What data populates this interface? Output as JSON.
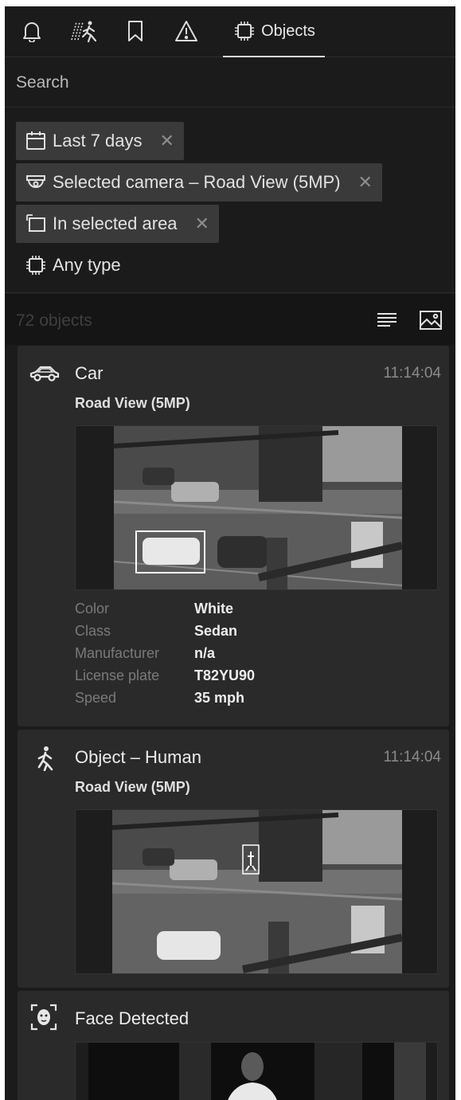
{
  "tabs": {
    "bell_icon": "bell-icon",
    "motion_icon": "motion-human-icon",
    "bookmark_icon": "bookmark-icon",
    "alert_icon": "warning-triangle-icon",
    "objects_icon": "chip-icon",
    "objects_label": "Objects"
  },
  "search": {
    "placeholder": "Search",
    "value": ""
  },
  "filters": {
    "date": "Last 7 days",
    "camera": "Selected camera – Road View (5MP)",
    "area": "In selected area",
    "type": "Any type",
    "remove_glyph": "✕"
  },
  "results": {
    "count_text": "72 objects"
  },
  "cards": [
    {
      "icon": "car-icon",
      "title": "Car",
      "time": "11:14:04",
      "camera": "Road View (5MP)",
      "attributes": [
        {
          "key": "Color",
          "value": "White"
        },
        {
          "key": "Class",
          "value": "Sedan"
        },
        {
          "key": "Manufacturer",
          "value": "n/a"
        },
        {
          "key": "License plate",
          "value": "T82YU90"
        },
        {
          "key": "Speed",
          "value": "35 mph"
        }
      ]
    },
    {
      "icon": "human-walking-icon",
      "title": "Object – Human",
      "time": "11:14:04",
      "camera": "Road View (5MP)"
    },
    {
      "icon": "face-scan-icon",
      "title": "Face Detected"
    }
  ],
  "colors": {
    "panel_bg": "#1b1b1b",
    "card_bg": "#2a2a2a",
    "chip_bg": "#3a3a3a",
    "text": "#e6e6e6",
    "muted": "#7a7a7a"
  }
}
